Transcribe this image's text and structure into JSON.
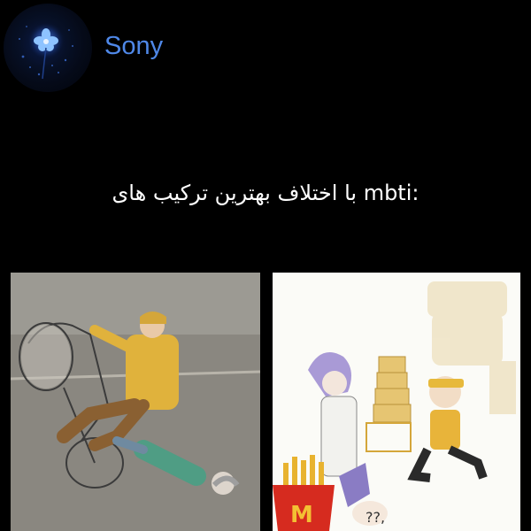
{
  "post": {
    "author": {
      "name": "Sony",
      "avatar_icon": "glowing-flower-icon"
    },
    "caption": "با اختلاف بهترین ترکیب های mbti:",
    "images": [
      {
        "name": "wheelie-motorcycle-comic"
      },
      {
        "name": "chef-kitchen-comic",
        "text": "??,"
      }
    ]
  },
  "colors": {
    "background": "#000000",
    "username": "#4f88e8",
    "caption": "#ffffff"
  }
}
